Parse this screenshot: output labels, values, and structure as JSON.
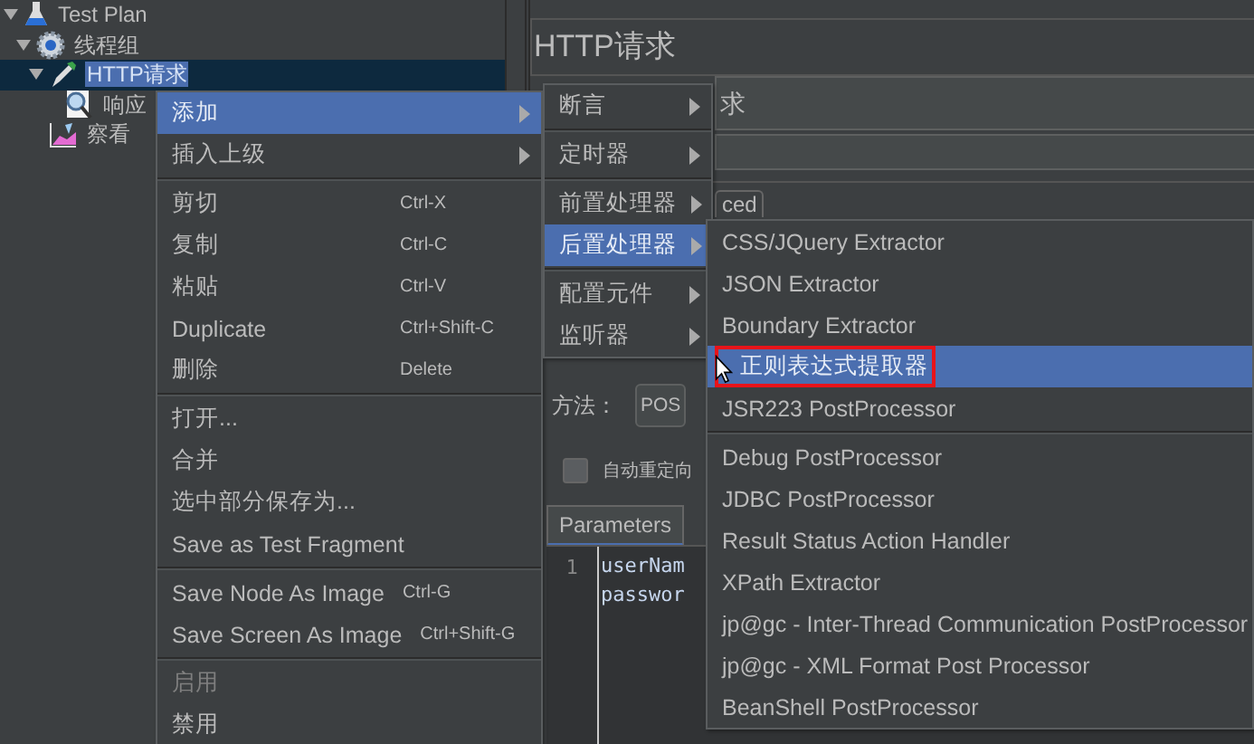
{
  "tree": [
    {
      "label": "Test Plan",
      "kind": "plan",
      "expanded": true,
      "selected": false,
      "children": [
        {
          "label": "线程组",
          "kind": "group",
          "expanded": true,
          "selected": false,
          "children": [
            {
              "label": "HTTP请求",
              "kind": "sampler",
              "expanded": true,
              "selected": true,
              "children": [
                {
                  "label": "响应",
                  "kind": "viewer",
                  "selected": false
                }
              ]
            },
            {
              "label": "察看",
              "kind": "graph",
              "selected": false
            }
          ]
        }
      ]
    }
  ],
  "editor": {
    "title": "HTTP请求",
    "name_value": "求",
    "tab": "ced",
    "method_label": "方法：",
    "method_value": "POS",
    "redirect": {
      "label": "自动重定向",
      "checked": false
    },
    "params_tab": "Parameters",
    "line_number": "1",
    "code_lines": [
      "userNam",
      "passwor"
    ]
  },
  "context_menu": {
    "items": [
      {
        "kind": "item",
        "label": "添加",
        "submenu": true,
        "selected": true
      },
      {
        "kind": "item",
        "label": "插入上级",
        "submenu": true,
        "selected": false
      },
      {
        "kind": "separator"
      },
      {
        "kind": "item",
        "label": "剪切",
        "shortcut": "Ctrl-X",
        "selected": false
      },
      {
        "kind": "item",
        "label": "复制",
        "shortcut": "Ctrl-C",
        "selected": false
      },
      {
        "kind": "item",
        "label": "粘贴",
        "shortcut": "Ctrl-V",
        "selected": false
      },
      {
        "kind": "item",
        "label": "Duplicate",
        "shortcut": "Ctrl+Shift-C",
        "selected": false
      },
      {
        "kind": "item",
        "label": "删除",
        "shortcut": "Delete",
        "selected": false
      },
      {
        "kind": "separator"
      },
      {
        "kind": "item",
        "label": "打开...",
        "selected": false
      },
      {
        "kind": "item",
        "label": "合并",
        "selected": false
      },
      {
        "kind": "item",
        "label": "选中部分保存为...",
        "selected": false
      },
      {
        "kind": "item",
        "label": "Save as Test Fragment",
        "selected": false
      },
      {
        "kind": "separator"
      },
      {
        "kind": "item",
        "label": "Save Node As Image",
        "shortcut": "Ctrl-G",
        "selected": false
      },
      {
        "kind": "item",
        "label": "Save Screen As Image",
        "shortcut": "Ctrl+Shift-G",
        "selected": false
      },
      {
        "kind": "separator"
      },
      {
        "kind": "item",
        "label": "启用",
        "selected": false,
        "disabled": true
      },
      {
        "kind": "item",
        "label": "禁用",
        "selected": false
      }
    ]
  },
  "add_submenu": {
    "items": [
      {
        "kind": "item",
        "label": "断言",
        "submenu": true,
        "selected": false
      },
      {
        "kind": "separator"
      },
      {
        "kind": "item",
        "label": "定时器",
        "submenu": true,
        "selected": false
      },
      {
        "kind": "separator"
      },
      {
        "kind": "item",
        "label": "前置处理器",
        "submenu": true,
        "selected": false
      },
      {
        "kind": "item",
        "label": "后置处理器",
        "submenu": true,
        "selected": true
      },
      {
        "kind": "separator"
      },
      {
        "kind": "item",
        "label": "配置元件",
        "submenu": true,
        "selected": false
      },
      {
        "kind": "item",
        "label": "监听器",
        "submenu": true,
        "selected": false
      }
    ]
  },
  "post_processor_submenu": {
    "items": [
      {
        "kind": "item",
        "label": "CSS/JQuery Extractor",
        "selected": false
      },
      {
        "kind": "item",
        "label": "JSON Extractor",
        "selected": false
      },
      {
        "kind": "item",
        "label": "Boundary Extractor",
        "selected": false
      },
      {
        "kind": "item",
        "label": "正则表达式提取器",
        "selected": true,
        "outlined": true
      },
      {
        "kind": "item",
        "label": "JSR223 PostProcessor",
        "selected": false
      },
      {
        "kind": "separator"
      },
      {
        "kind": "item",
        "label": "Debug PostProcessor",
        "selected": false
      },
      {
        "kind": "item",
        "label": "JDBC PostProcessor",
        "selected": false
      },
      {
        "kind": "item",
        "label": "Result Status Action Handler",
        "selected": false
      },
      {
        "kind": "item",
        "label": "XPath Extractor",
        "selected": false
      },
      {
        "kind": "item",
        "label": "jp@gc - Inter-Thread Communication PostProcessor",
        "selected": false
      },
      {
        "kind": "item",
        "label": "jp@gc - XML Format Post Processor",
        "selected": false
      },
      {
        "kind": "item",
        "label": "BeanShell PostProcessor",
        "selected": false
      }
    ]
  }
}
